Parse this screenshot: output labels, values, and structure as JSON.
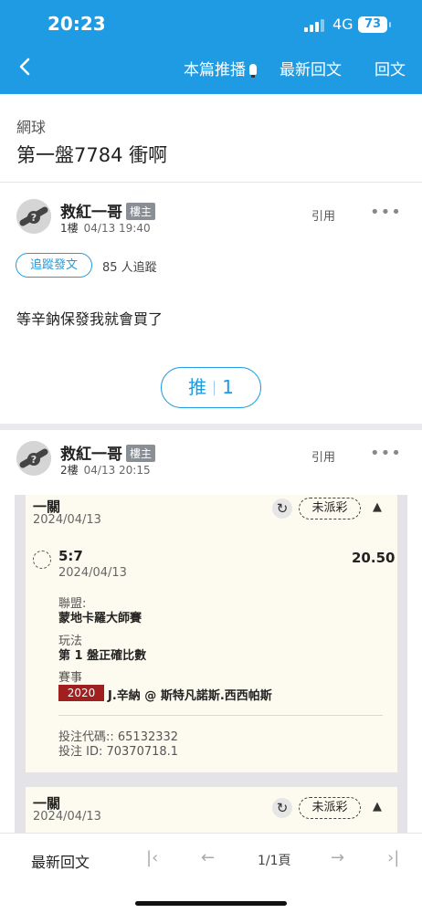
{
  "status_bar": {
    "time": "20:23",
    "network": "4G",
    "battery": "73"
  },
  "nav": {
    "recommend": "本篇推播",
    "latest": "最新回文",
    "reply": "回文"
  },
  "thread": {
    "category": "網球",
    "title": "第一盤7784 衝啊"
  },
  "posts": [
    {
      "author": "救紅一哥",
      "badge": "樓主",
      "floor": "1樓",
      "time": "04/13 19:40",
      "quote": "引用",
      "more": "•••",
      "follow_label": "追蹤發文",
      "follow_count": "85 人追蹤",
      "body": "等辛鈉保發我就會買了",
      "push_label": "推",
      "push_count": "1"
    },
    {
      "author": "救紅一哥",
      "badge": "樓主",
      "floor": "2樓",
      "time": "04/13 20:15",
      "quote": "引用",
      "more": "•••"
    }
  ],
  "tickets": [
    {
      "type": "一關",
      "date": "2024/04/13",
      "status": "未派彩",
      "pick": "5:7",
      "pick_date": "2024/04/13",
      "odds": "20.50",
      "league_label": "聯盟:",
      "league": "蒙地卡羅大師賽",
      "play_label": "玩法",
      "play": "第 1 盤正確比數",
      "event_label": "賽事",
      "event_year": "2020",
      "event": "J.辛納 @ 斯特凡諾斯.西西帕斯",
      "bet_code": "投注代碼:: 65132332",
      "bet_id": "投注 ID: 70370718.1"
    },
    {
      "type": "一關",
      "date": "2024/04/13",
      "status": "未派彩"
    }
  ],
  "bottom": {
    "latest_label": "最新回文",
    "page": "1/1頁"
  },
  "colors": {
    "accent": "#1f9be3",
    "ticket_bg": "#fdfbef",
    "tag_red": "#a01f1f"
  }
}
